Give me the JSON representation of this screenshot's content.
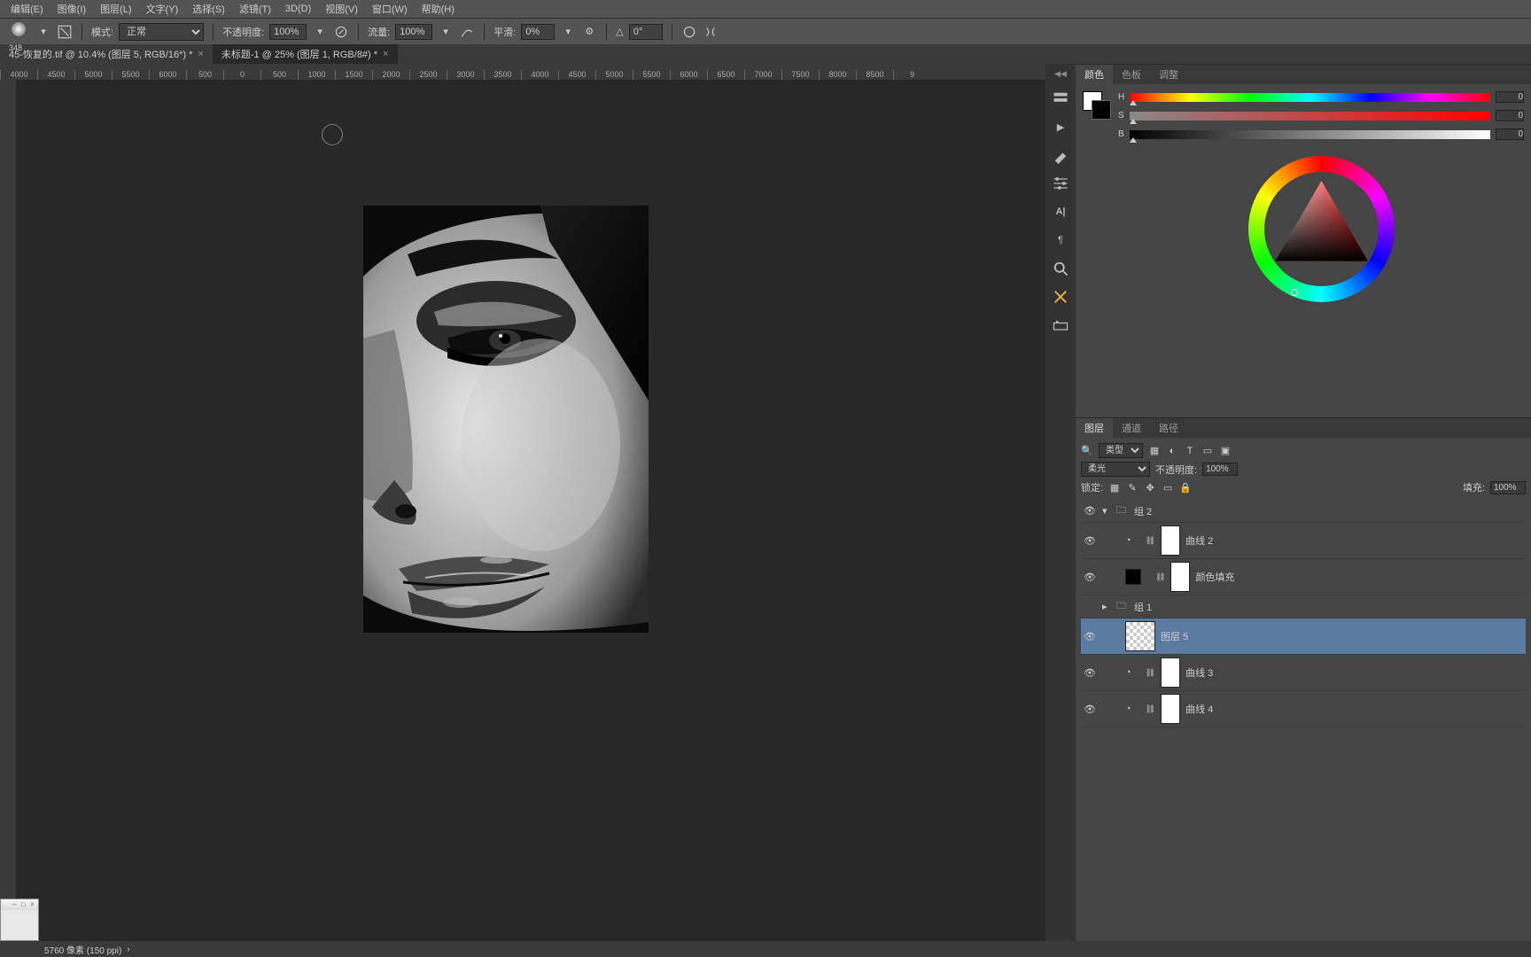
{
  "menu": [
    "编辑(E)",
    "图像(I)",
    "图层(L)",
    "文字(Y)",
    "选择(S)",
    "滤镜(T)",
    "3D(D)",
    "视图(V)",
    "窗口(W)",
    "帮助(H)"
  ],
  "brush": {
    "size": "348"
  },
  "options": {
    "mode_label": "模式:",
    "mode_value": "正常",
    "opacity_label": "不透明度:",
    "opacity_value": "100%",
    "flow_label": "流量:",
    "flow_value": "100%",
    "smoothing_label": "平滑:",
    "smoothing_value": "0%",
    "angle_label": "△",
    "angle_value": "0°"
  },
  "tabs": [
    {
      "label": "45-恢复的.tif @ 10.4% (图层 5, RGB/16*) *",
      "active": false
    },
    {
      "label": "未标题-1 @ 25% (图层 1, RGB/8#) *",
      "active": true
    }
  ],
  "ruler_ticks": [
    "4000",
    "4500",
    "5000",
    "5500",
    "6000",
    "500",
    "0",
    "500",
    "1000",
    "1500",
    "2000",
    "2500",
    "3000",
    "3500",
    "4000",
    "4500",
    "5000",
    "5500",
    "6000",
    "6500",
    "7000",
    "7500",
    "8000",
    "8500",
    "9"
  ],
  "color_panel": {
    "tabs": [
      "颜色",
      "色板",
      "调整"
    ],
    "h_label": "H",
    "h_value": "0",
    "s_label": "S",
    "s_value": "0",
    "b_label": "B",
    "b_value": "0"
  },
  "layers_panel": {
    "tabs": [
      "图层",
      "通道",
      "路径"
    ],
    "filter_label": "类型",
    "blend_mode": "柔光",
    "opacity_label": "不透明度:",
    "opacity_value": "100%",
    "lock_label": "锁定:",
    "fill_label": "填充:",
    "fill_value": "100%",
    "layers": [
      {
        "kind": "group",
        "name": "组 2",
        "open": true,
        "eye": true
      },
      {
        "kind": "adj",
        "name": "曲线 2",
        "eye": true,
        "indent": 1,
        "thumb": "white",
        "adjicon": "curves"
      },
      {
        "kind": "adj",
        "name": "颜色填充",
        "eye": true,
        "indent": 1,
        "thumb": "white",
        "swatch": "black"
      },
      {
        "kind": "group",
        "name": "组 1",
        "open": false,
        "eye": false
      },
      {
        "kind": "pixel",
        "name": "图层 5",
        "eye": true,
        "indent": 1,
        "thumb": "checker",
        "selected": true
      },
      {
        "kind": "adj",
        "name": "曲线 3",
        "eye": true,
        "indent": 1,
        "thumb": "white",
        "adjicon": "curves"
      },
      {
        "kind": "adj",
        "name": "曲线 4",
        "eye": true,
        "indent": 1,
        "thumb": "grey",
        "adjicon": "curves"
      }
    ]
  },
  "status": {
    "doc_info": "5760 像素 (150 ppi)",
    "arrow": "›"
  }
}
